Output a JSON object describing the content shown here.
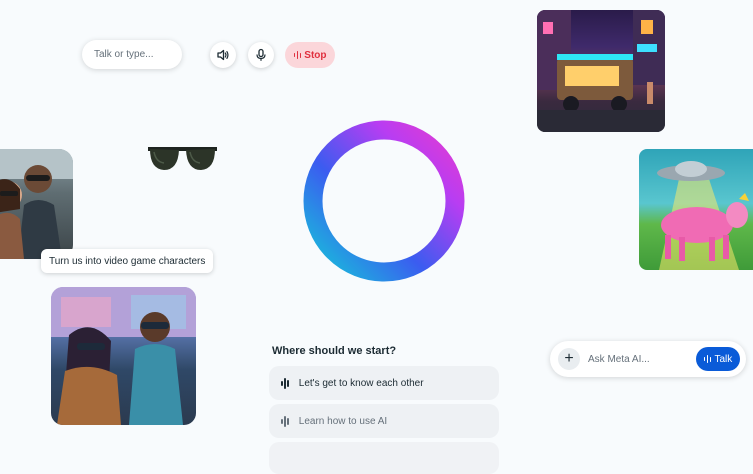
{
  "voice_bar": {
    "input_placeholder": "Talk or type...",
    "speaker_icon": "speaker-icon",
    "mic_icon": "microphone-icon",
    "stop_label": "Stop",
    "stop_color": "#e0303f"
  },
  "caption": "Turn us into video game characters",
  "prompts": {
    "title": "Where should we start?",
    "items": [
      {
        "label": "Let's get to know each other"
      },
      {
        "label": "Learn how to use AI"
      }
    ]
  },
  "ask": {
    "placeholder": "Ask Meta AI...",
    "talk_label": "Talk",
    "accent": "#0a5bd8"
  },
  "ring_colors": [
    "#16c5d9",
    "#3b5cf0",
    "#b83df2",
    "#e63bd0"
  ]
}
